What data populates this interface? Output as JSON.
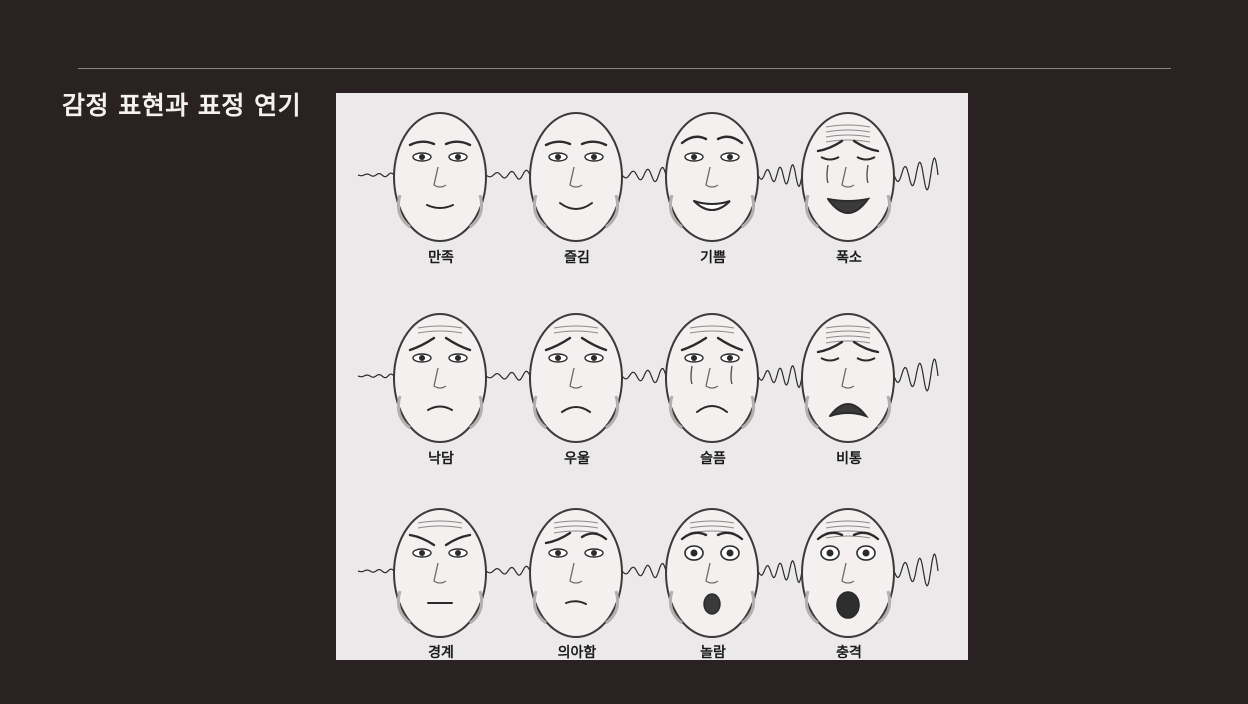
{
  "slide": {
    "title": "감정 표현과 표정 연기"
  },
  "colors": {
    "background": "#2a2122",
    "panel": "#ece9ea",
    "ink": "#2b2b2b"
  },
  "rows": [
    {
      "faces": [
        {
          "label": "만족",
          "expression": "content"
        },
        {
          "label": "즐김",
          "expression": "smile"
        },
        {
          "label": "기쁨",
          "expression": "grin"
        },
        {
          "label": "폭소",
          "expression": "laugh"
        }
      ]
    },
    {
      "faces": [
        {
          "label": "낙담",
          "expression": "dejected"
        },
        {
          "label": "우울",
          "expression": "gloomy"
        },
        {
          "label": "슬픔",
          "expression": "sad"
        },
        {
          "label": "비통",
          "expression": "anguish"
        }
      ]
    },
    {
      "faces": [
        {
          "label": "경계",
          "expression": "wary"
        },
        {
          "label": "의아함",
          "expression": "puzzled"
        },
        {
          "label": "놀람",
          "expression": "surprise"
        },
        {
          "label": "충격",
          "expression": "shock"
        }
      ]
    }
  ]
}
